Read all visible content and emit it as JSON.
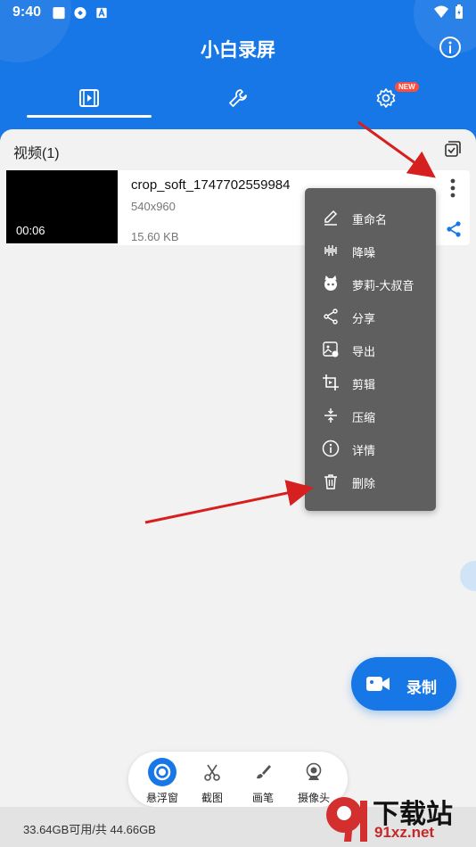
{
  "status_bar": {
    "time": "9:40"
  },
  "app": {
    "title": "小白录屏"
  },
  "tabs": [
    {
      "name": "videos",
      "icon": "film-icon"
    },
    {
      "name": "tools",
      "icon": "wrench-icon"
    },
    {
      "name": "settings",
      "icon": "gear-icon",
      "badge": "NEW"
    }
  ],
  "section": {
    "title": "视频(1)"
  },
  "video": {
    "filename": "crop_soft_1747702559984",
    "resolution": "540x960",
    "size": "15.60 KB",
    "duration": "00:06"
  },
  "menu": {
    "items": [
      {
        "label": "重命名",
        "icon": "pencil-icon"
      },
      {
        "label": "降噪",
        "icon": "waveform-icon"
      },
      {
        "label": "萝莉-大叔音",
        "icon": "voice-mask-icon"
      },
      {
        "label": "分享",
        "icon": "share-icon"
      },
      {
        "label": "导出",
        "icon": "export-image-icon"
      },
      {
        "label": "剪辑",
        "icon": "crop-icon"
      },
      {
        "label": "压缩",
        "icon": "compress-icon"
      },
      {
        "label": "详情",
        "icon": "info-icon"
      },
      {
        "label": "删除",
        "icon": "trash-icon"
      }
    ]
  },
  "record": {
    "label": "录制"
  },
  "toolbar": {
    "items": [
      {
        "label": "悬浮窗",
        "icon": "floating-window-icon"
      },
      {
        "label": "截图",
        "icon": "scissors-icon"
      },
      {
        "label": "画笔",
        "icon": "brush-icon"
      },
      {
        "label": "摄像头",
        "icon": "webcam-icon"
      }
    ]
  },
  "storage": {
    "text": "33.64GB可用/共 44.66GB"
  },
  "watermark": {
    "line1": "下载站",
    "line2": "91xz.net"
  },
  "colors": {
    "primary": "#1877e6",
    "menu_bg": "#5f5f5f",
    "arrow": "#d61f1f"
  }
}
